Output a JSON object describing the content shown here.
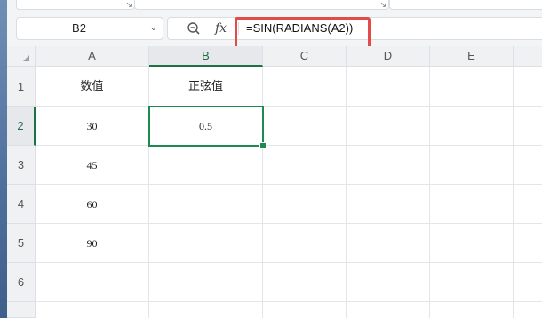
{
  "name_box": {
    "value": "B2"
  },
  "formula_bar": {
    "fx_label": "fx",
    "formula": "=SIN(RADIANS(A2))"
  },
  "columns": [
    "A",
    "B",
    "C",
    "D",
    "E"
  ],
  "rows": [
    "1",
    "2",
    "3",
    "4",
    "5",
    "6"
  ],
  "cells": {
    "A1": "数值",
    "B1": "正弦值",
    "A2": "30",
    "B2": "0.5",
    "A3": "45",
    "A4": "60",
    "A5": "90"
  },
  "selected_cell": "B2",
  "colors": {
    "accent": "#1e8a52",
    "highlight_box": "#e24b47"
  }
}
